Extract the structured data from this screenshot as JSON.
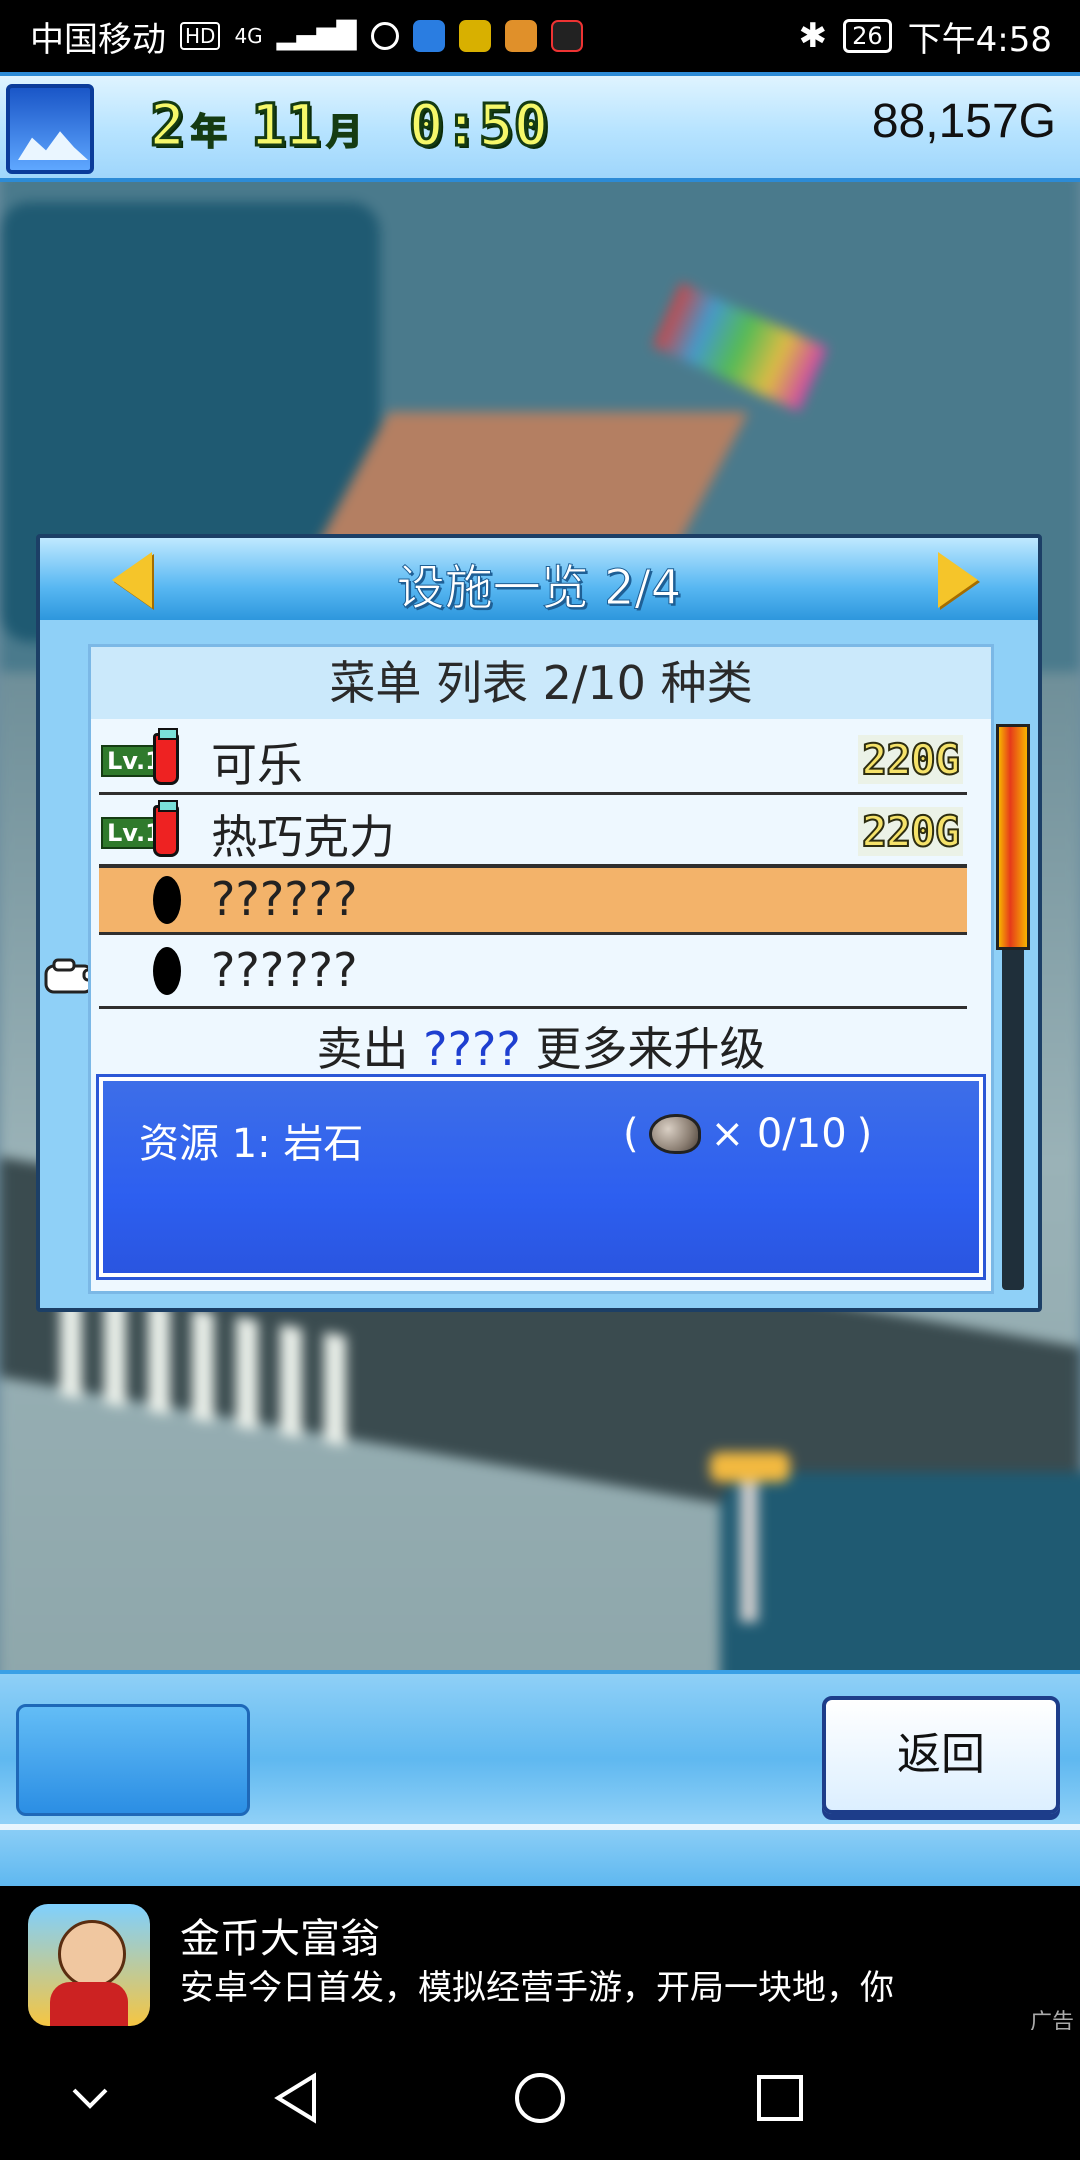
{
  "status_bar": {
    "carrier": "中国移动",
    "hd_badge": "HD",
    "network": "4G",
    "battery": "26",
    "time": "下午4:58"
  },
  "hud": {
    "year_num": "2",
    "year_unit": "年",
    "month_num": "11",
    "month_unit": "月",
    "time": "0:50",
    "money": "88,157G"
  },
  "dialog": {
    "title": "设施一览 2/4",
    "subtitle": "菜单 列表 2/10 种类",
    "items": [
      {
        "level": "Lv.1",
        "name": "可乐",
        "price": "220G",
        "icon": "cup-icon"
      },
      {
        "level": "Lv.1",
        "name": "热巧克力",
        "price": "220G",
        "icon": "cup-icon"
      },
      {
        "name": "??????",
        "icon": "mystery-icon",
        "selected": true
      },
      {
        "name": "??????",
        "icon": "mystery-icon"
      }
    ],
    "hint_prefix": "卖出",
    "hint_q": "????",
    "hint_suffix": "更多来升级",
    "resource": {
      "label": "资源 1: 岩石",
      "open_paren": "(",
      "count": "× 0/10",
      "close_paren": ")"
    }
  },
  "bottom_bar": {
    "back_label": "返回"
  },
  "ad": {
    "title": "金币大富翁",
    "description": "安卓今日首发，模拟经营手游，开局一块地，你",
    "tag": "广告"
  },
  "colors": {
    "hud_blue": "#2c8bd6",
    "selected_row": "#f3b36a",
    "resource_blue": "#2d5ff0",
    "hint_question": "#1e3fd0"
  }
}
